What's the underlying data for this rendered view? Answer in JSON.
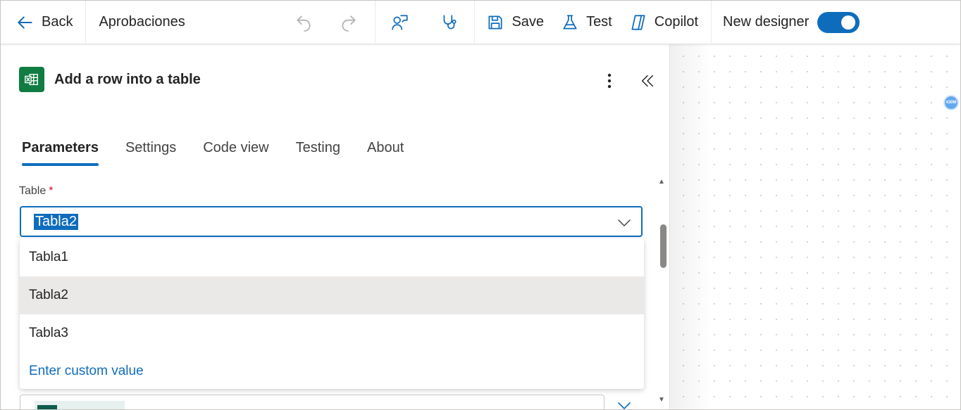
{
  "toolbar": {
    "back_label": "Back",
    "flow_name": "Aprobaciones",
    "save_label": "Save",
    "test_label": "Test",
    "copilot_label": "Copilot",
    "new_designer_label": "New designer",
    "new_designer_on": true
  },
  "panel": {
    "title": "Add a row into a table",
    "connector_icon": "excel-icon",
    "tabs": [
      {
        "label": "Parameters",
        "active": true
      },
      {
        "label": "Settings",
        "active": false
      },
      {
        "label": "Code view",
        "active": false
      },
      {
        "label": "Testing",
        "active": false
      },
      {
        "label": "About",
        "active": false
      }
    ],
    "table_field": {
      "label": "Table",
      "required_mark": "*",
      "value": "Tabla2",
      "options": [
        "Tabla1",
        "Tabla2",
        "Tabla3"
      ],
      "selected_option": "Tabla2",
      "custom_value_label": "Enter custom value"
    }
  },
  "canvas": {
    "badge_text": "430M"
  },
  "colors": {
    "accent": "#0f6cbd",
    "excel_green": "#107c41",
    "required": "#c50f1f"
  }
}
